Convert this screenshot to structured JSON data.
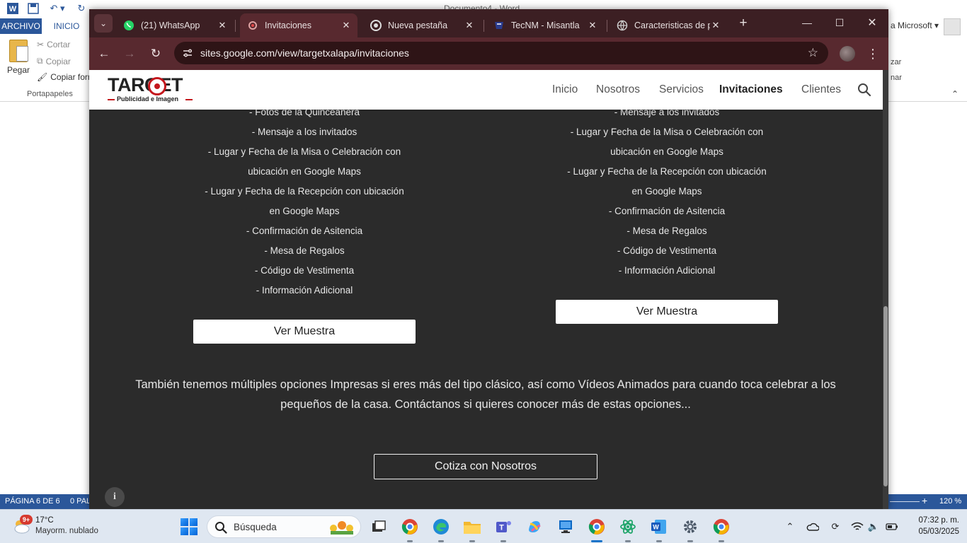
{
  "word": {
    "title": "Documento4 - Word",
    "ribbon_tabs": {
      "file": "ARCHIVO",
      "home": "INICIO"
    },
    "clipboard": {
      "paste": "Pegar",
      "cut": "Cortar",
      "copy": "Copiar",
      "format_painter": "Copiar formato",
      "group_label": "Portapapeles"
    },
    "account_fragment": "a Microsoft",
    "right_fragments": {
      "replace": "zar",
      "select": "nar"
    },
    "status": {
      "page": "PÁGINA 6 DE 6",
      "words": "0 PAL",
      "zoom": "120 %"
    }
  },
  "browser": {
    "tabs": [
      {
        "title": "(21) WhatsApp",
        "icon": "whatsapp-icon",
        "active": false
      },
      {
        "title": "Invitaciones",
        "icon": "google-sites-icon",
        "active": true
      },
      {
        "title": "Nueva pestaña",
        "icon": "chrome-icon",
        "active": false
      },
      {
        "title": "TecNM - Misantla",
        "icon": "tecnm-icon",
        "active": false
      },
      {
        "title": "Caracteristicas de p",
        "icon": "globe-icon",
        "active": false
      }
    ],
    "url": "sites.google.com/view/targetxalapa/invitaciones",
    "theme_color": "#58292f"
  },
  "site": {
    "logo": {
      "word": "TARGET",
      "tagline": "Publicidad e Imagen"
    },
    "nav": [
      "Inicio",
      "Nosotros",
      "Servicios",
      "Invitaciones",
      "Clientes"
    ],
    "active_nav": "Invitaciones",
    "left_features": [
      "- Fotos de la Quinceañera",
      "- Mensaje a los invitados",
      "- Lugar y Fecha de la Misa o Celebración con",
      "ubicación en Google Maps",
      "- Lugar y Fecha de la Recepción con ubicación",
      "en Google Maps",
      "- Confirmación de Asitencia",
      "- Mesa de Regalos",
      "- Código de Vestimenta",
      "- Información Adicional"
    ],
    "right_features": [
      "- Mensaje a los invitados",
      "- Lugar y Fecha de la Misa o Celebración con",
      "ubicación en Google Maps",
      "- Lugar y Fecha de la Recepción con ubicación",
      "en Google Maps",
      "- Confirmación de Asitencia",
      "- Mesa de Regalos",
      "- Código de Vestimenta",
      "- Información Adicional"
    ],
    "sample_button": "Ver Muestra",
    "also_text": "También tenemos múltiples opciones Impresas si eres más del tipo clásico, así como Vídeos Animados para cuando toca celebrar a los pequeños de la casa. Contáctanos si quieres conocer más de estas opciones...",
    "quote_button": "Cotiza con Nosotros",
    "accent_color": "#c4161c"
  },
  "taskbar": {
    "weather": {
      "badge": "9+",
      "temp": "17°C",
      "desc": "Mayorm. nublado"
    },
    "search_placeholder": "Búsqueda",
    "apps": [
      "task-view",
      "chrome",
      "edge",
      "file-explorer",
      "teams",
      "copilot",
      "remote-desktop",
      "chrome-active",
      "atom",
      "word",
      "settings",
      "chrome-profile"
    ],
    "clock": {
      "time": "07:32 p. m.",
      "date": "05/03/2025"
    }
  }
}
